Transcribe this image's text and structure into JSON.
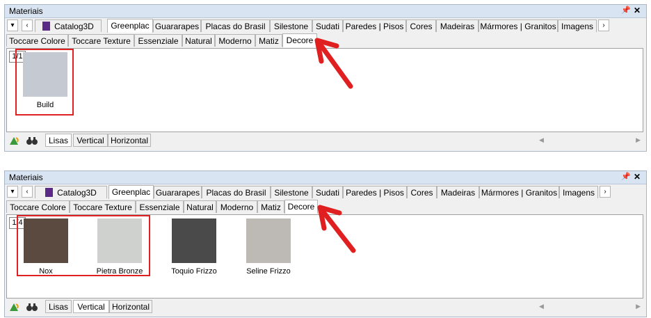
{
  "panels": [
    {
      "title": "Materiais",
      "main_tabs": [
        "Catalog3D",
        "Greenplac",
        "Guararapes",
        "Placas do Brasil",
        "Silestone",
        "Sudati",
        "Paredes | Pisos",
        "Cores",
        "Madeiras",
        "Mármores | Granitos",
        "Imagens"
      ],
      "selected_main": "Greenplac",
      "sub_tabs": [
        "Toccare Colore",
        "Toccare Texture",
        "Essenziale",
        "Natural",
        "Moderno",
        "Matiz",
        "Decore"
      ],
      "selected_sub": "Decore",
      "count": "1/1",
      "items": [
        {
          "name": "Build",
          "color": "#c5c9d2"
        }
      ],
      "bottom_tabs": [
        "Lisas",
        "Vertical",
        "Horizontal"
      ],
      "selected_bottom": "Lisas"
    },
    {
      "title": "Materiais",
      "main_tabs": [
        "Catalog3D",
        "Greenplac",
        "Guararapes",
        "Placas do Brasil",
        "Silestone",
        "Sudati",
        "Paredes | Pisos",
        "Cores",
        "Madeiras",
        "Mármores | Granitos",
        "Imagens"
      ],
      "selected_main": "Greenplac",
      "sub_tabs": [
        "Toccare Colore",
        "Toccare Texture",
        "Essenziale",
        "Natural",
        "Moderno",
        "Matiz",
        "Decore"
      ],
      "selected_sub": "Decore",
      "count": "1/4",
      "items": [
        {
          "name": "Nox",
          "color": "#5a4a3f"
        },
        {
          "name": "Pietra Bronze",
          "color": "#cfd1ce"
        },
        {
          "name": "Toquio Frizzo",
          "color": "#4a4a4a"
        },
        {
          "name": "Seline Frizzo",
          "color": "#bdb9b4"
        }
      ],
      "bottom_tabs": [
        "Lisas",
        "Vertical",
        "Horizontal"
      ],
      "selected_bottom": "Vertical"
    }
  ],
  "icons": {
    "pin": "pin-icon",
    "close": "close-icon",
    "catalog": "purple-cube-icon",
    "refresh": "green-arrow-icon",
    "find": "binoculars-icon"
  },
  "colors": {
    "highlight": "#e02020",
    "title_bg": "#d9e4f2"
  }
}
